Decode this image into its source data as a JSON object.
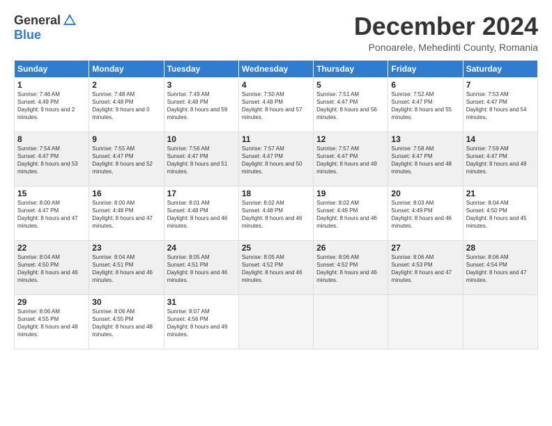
{
  "header": {
    "logo_general": "General",
    "logo_blue": "Blue",
    "month_title": "December 2024",
    "location": "Ponoarele, Mehedinti County, Romania"
  },
  "weekdays": [
    "Sunday",
    "Monday",
    "Tuesday",
    "Wednesday",
    "Thursday",
    "Friday",
    "Saturday"
  ],
  "weeks": [
    [
      {
        "day": "1",
        "sunrise": "7:46 AM",
        "sunset": "4:49 PM",
        "daylight": "9 hours and 2 minutes."
      },
      {
        "day": "2",
        "sunrise": "7:48 AM",
        "sunset": "4:48 PM",
        "daylight": "9 hours and 0 minutes."
      },
      {
        "day": "3",
        "sunrise": "7:49 AM",
        "sunset": "4:48 PM",
        "daylight": "8 hours and 59 minutes."
      },
      {
        "day": "4",
        "sunrise": "7:50 AM",
        "sunset": "4:48 PM",
        "daylight": "8 hours and 57 minutes."
      },
      {
        "day": "5",
        "sunrise": "7:51 AM",
        "sunset": "4:47 PM",
        "daylight": "8 hours and 56 minutes."
      },
      {
        "day": "6",
        "sunrise": "7:52 AM",
        "sunset": "4:47 PM",
        "daylight": "8 hours and 55 minutes."
      },
      {
        "day": "7",
        "sunrise": "7:53 AM",
        "sunset": "4:47 PM",
        "daylight": "8 hours and 54 minutes."
      }
    ],
    [
      {
        "day": "8",
        "sunrise": "7:54 AM",
        "sunset": "4:47 PM",
        "daylight": "8 hours and 53 minutes."
      },
      {
        "day": "9",
        "sunrise": "7:55 AM",
        "sunset": "4:47 PM",
        "daylight": "8 hours and 52 minutes."
      },
      {
        "day": "10",
        "sunrise": "7:56 AM",
        "sunset": "4:47 PM",
        "daylight": "8 hours and 51 minutes."
      },
      {
        "day": "11",
        "sunrise": "7:57 AM",
        "sunset": "4:47 PM",
        "daylight": "8 hours and 50 minutes."
      },
      {
        "day": "12",
        "sunrise": "7:57 AM",
        "sunset": "4:47 PM",
        "daylight": "8 hours and 49 minutes."
      },
      {
        "day": "13",
        "sunrise": "7:58 AM",
        "sunset": "4:47 PM",
        "daylight": "8 hours and 48 minutes."
      },
      {
        "day": "14",
        "sunrise": "7:59 AM",
        "sunset": "4:47 PM",
        "daylight": "8 hours and 48 minutes."
      }
    ],
    [
      {
        "day": "15",
        "sunrise": "8:00 AM",
        "sunset": "4:47 PM",
        "daylight": "8 hours and 47 minutes."
      },
      {
        "day": "16",
        "sunrise": "8:00 AM",
        "sunset": "4:48 PM",
        "daylight": "8 hours and 47 minutes."
      },
      {
        "day": "17",
        "sunrise": "8:01 AM",
        "sunset": "4:48 PM",
        "daylight": "8 hours and 46 minutes."
      },
      {
        "day": "18",
        "sunrise": "8:02 AM",
        "sunset": "4:48 PM",
        "daylight": "8 hours and 46 minutes."
      },
      {
        "day": "19",
        "sunrise": "8:02 AM",
        "sunset": "4:49 PM",
        "daylight": "8 hours and 46 minutes."
      },
      {
        "day": "20",
        "sunrise": "8:03 AM",
        "sunset": "4:49 PM",
        "daylight": "8 hours and 46 minutes."
      },
      {
        "day": "21",
        "sunrise": "8:04 AM",
        "sunset": "4:50 PM",
        "daylight": "8 hours and 45 minutes."
      }
    ],
    [
      {
        "day": "22",
        "sunrise": "8:04 AM",
        "sunset": "4:50 PM",
        "daylight": "8 hours and 46 minutes."
      },
      {
        "day": "23",
        "sunrise": "8:04 AM",
        "sunset": "4:51 PM",
        "daylight": "8 hours and 46 minutes."
      },
      {
        "day": "24",
        "sunrise": "8:05 AM",
        "sunset": "4:51 PM",
        "daylight": "8 hours and 46 minutes."
      },
      {
        "day": "25",
        "sunrise": "8:05 AM",
        "sunset": "4:52 PM",
        "daylight": "8 hours and 46 minutes."
      },
      {
        "day": "26",
        "sunrise": "8:06 AM",
        "sunset": "4:52 PM",
        "daylight": "8 hours and 46 minutes."
      },
      {
        "day": "27",
        "sunrise": "8:06 AM",
        "sunset": "4:53 PM",
        "daylight": "8 hours and 47 minutes."
      },
      {
        "day": "28",
        "sunrise": "8:06 AM",
        "sunset": "4:54 PM",
        "daylight": "8 hours and 47 minutes."
      }
    ],
    [
      {
        "day": "29",
        "sunrise": "8:06 AM",
        "sunset": "4:55 PM",
        "daylight": "8 hours and 48 minutes."
      },
      {
        "day": "30",
        "sunrise": "8:06 AM",
        "sunset": "4:55 PM",
        "daylight": "8 hours and 48 minutes."
      },
      {
        "day": "31",
        "sunrise": "8:07 AM",
        "sunset": "4:56 PM",
        "daylight": "8 hours and 49 minutes."
      },
      null,
      null,
      null,
      null
    ]
  ]
}
